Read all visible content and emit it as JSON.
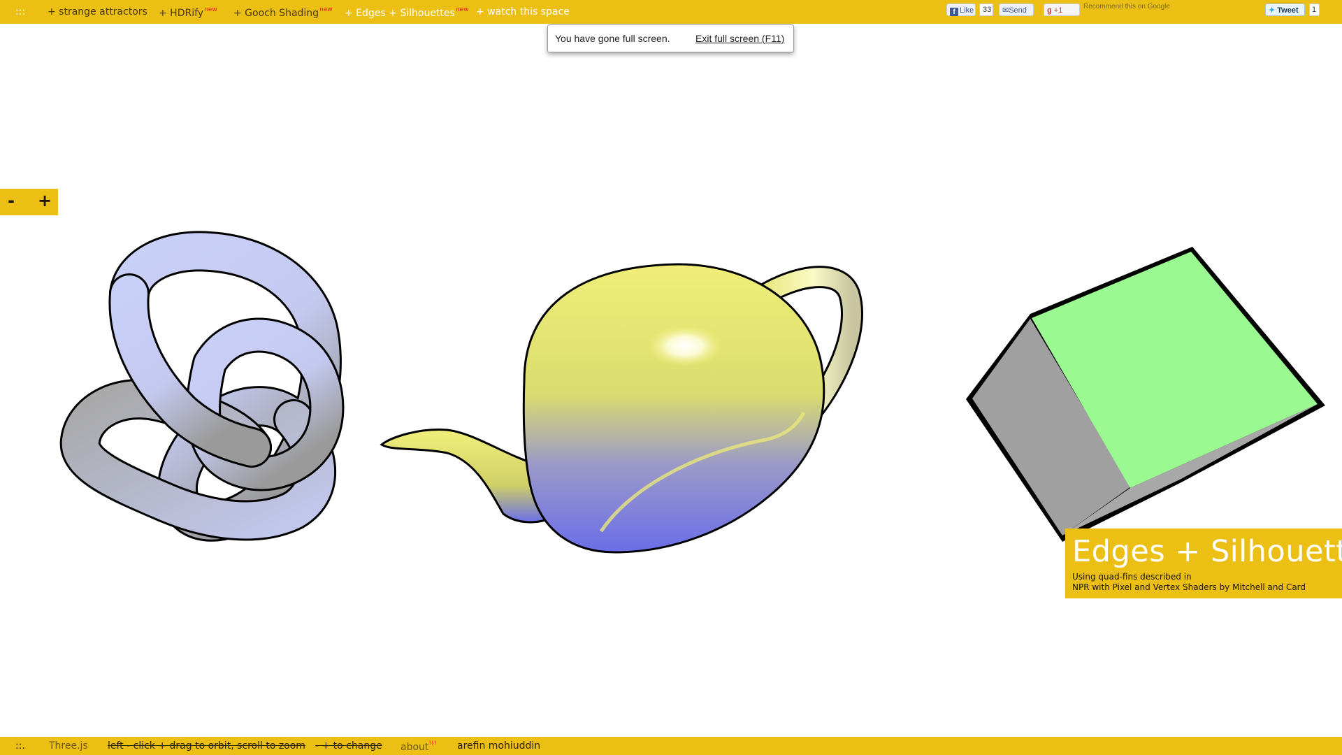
{
  "nav": {
    "menu_glyph": ":::",
    "items": [
      {
        "label": "+ strange attractors",
        "badge": ""
      },
      {
        "label": "+ HDRify",
        "badge": "new"
      },
      {
        "label": "+ Gooch Shading",
        "badge": "new"
      },
      {
        "label": "+ Edges + Silhouettes",
        "badge": "new"
      },
      {
        "label": "+ watch this space",
        "badge": ""
      }
    ]
  },
  "social": {
    "like_label": "Like",
    "like_count": "33",
    "send_label": "Send",
    "gplus_label": "+1",
    "gplus_text": "Recommend this on Google",
    "tweet_label": "Tweet",
    "tweet_count": "1"
  },
  "fullscreen_notice": {
    "message": "You have gone full screen.",
    "exit_label": "Exit full screen (F11)"
  },
  "zoom": {
    "minus_label": "-",
    "plus_label": "+"
  },
  "info_panel": {
    "title": "Edges + Silhouettes",
    "line1": "Using quad-fins described in",
    "line2": "NPR with Pixel and Vertex Shaders by Mitchell and Card"
  },
  "bottom": {
    "menu_glyph": "::.",
    "library": "Three.js",
    "instructions": "left - click + drag to orbit, scroll to zoom",
    "change_hint": "- + to change",
    "about_label": "about",
    "about_badge": "!!!",
    "author": "arefin mohiuddin"
  },
  "colors": {
    "bar": "#ecbf14",
    "knot": "#c9d0f7",
    "teapot_top": "#f2f07a",
    "teapot_bottom": "#6a6ee8",
    "cube_top": "#9af990",
    "cube_side": "#a0a0a0"
  }
}
